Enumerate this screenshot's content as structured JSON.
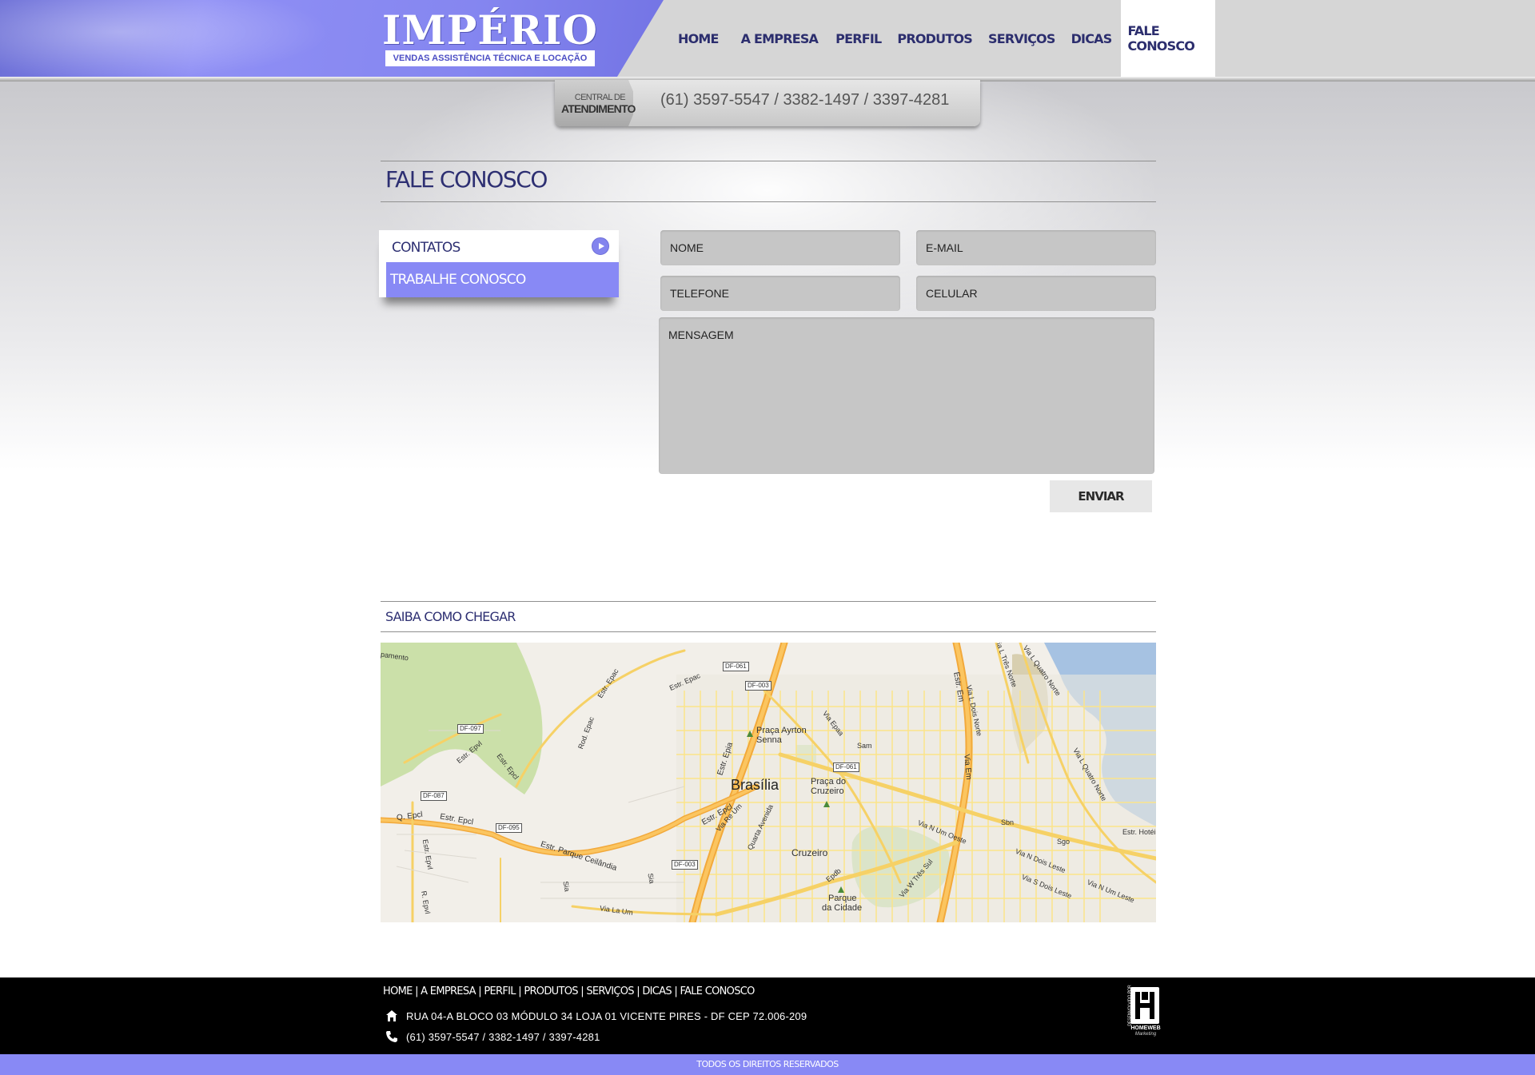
{
  "brand": {
    "name": "IMPÉRIO",
    "tagline": "VENDAS ASSISTÊNCIA TÉCNICA E LOCAÇÃO",
    "accent": "#8889f5",
    "navy": "#2d2f72"
  },
  "nav": {
    "items": [
      "HOME",
      "A EMPRESA",
      "PERFIL",
      "PRODUTOS",
      "SERVIÇOS",
      "DICAS",
      "FALE CONOSCO"
    ],
    "active": "FALE CONOSCO"
  },
  "phone_bar": {
    "label_top": "CENTRAL DE",
    "label_bottom": "ATENDIMENTO",
    "numbers": "(61) 3597-5547 / 3382-1497 / 3397-4281"
  },
  "page": {
    "title": "FALE CONOSCO",
    "side_menu": [
      "CONTATOS",
      "TRABALHE CONOSCO"
    ],
    "side_menu_selected": "TRABALHE CONOSCO"
  },
  "form": {
    "nome": "NOME",
    "email": "E-MAIL",
    "telefone": "TELEFONE",
    "celular": "CELULAR",
    "mensagem": "MENSAGEM",
    "submit": "ENVIAR"
  },
  "map_section": {
    "title": "SAIBA COMO CHEGAR",
    "labels": {
      "city": "Brasília",
      "praca_ayrton_1": "Praça Ayrton",
      "praca_ayrton_2": "Senna",
      "praca_cruzeiro_1": "Praça do",
      "praca_cruzeiro_2": "Cruzeiro",
      "cruzeiro": "Cruzeiro",
      "parque_1": "Parque",
      "parque_2": "da Cidade",
      "estr_epac": "Estr. Epac",
      "estr_epac_2": "Estr. Epac",
      "rod_epac": "Rod. Epac",
      "estr_epvl": "Estr. Epvl",
      "estr_epcl": "Estr. Epcl",
      "estr_epcl_2": "Estr. Epcl",
      "q_epcl": "Q. Epcl",
      "estr_epia": "Estr. Epia",
      "estr_em": "Estr. Em",
      "via_em": "Via Em",
      "estr_parque_ceilandia": "Estr. Parque Ceilândia",
      "via_n_um_oeste": "Via N Um Oeste",
      "via_n_dois_leste": "Via N Dois Leste",
      "via_s_dois_leste": "Via S Dois Leste",
      "via_l_dois_norte": "Via L Dois Norte",
      "via_l_tres_norte": "Via L Três Norte",
      "via_l_quatro_norte": "Via L Quatro Norte",
      "via_l_quatro_norte_2": "Via L Quatro Norte",
      "via_w_tres_sul": "Via W Três Sul",
      "via_epaa": "Via Epaa",
      "via_re_um": "Via Re Um",
      "quarta_avenida": "Quarta Avenida",
      "via_la_um": "Via La Um",
      "via_n_um_leste": "Via N Um Leste",
      "estr_hotel": "Estr. Hotéi",
      "sam": "Sam",
      "sbn": "Sbn",
      "sgo": "Sgo",
      "sia": "Sia",
      "sia_2": "Sia",
      "epdb": "Epdb",
      "r_epvl": "R. Epvl",
      "estr_epvl_2": "Estr. Epvl",
      "pamento": "pamento",
      "df_061": "DF-061",
      "df_003": "DF-003",
      "df_097": "DF-097",
      "df_087": "DF-087",
      "df_095": "DF-095",
      "df_061_b": "DF-061",
      "df_003_b": "DF-003"
    }
  },
  "footer": {
    "links": "HOME | A EMPRESA | PERFIL | PRODUTOS | SERVIÇOS | DICAS | FALE CONOSCO",
    "address": "RUA 04-A BLOCO 03 MÓDULO 34 LOJA 01 VICENTE PIRES - DF CEP 72.006-209",
    "phones": "(61) 3597-5547 / 3382-1497 / 3397-4281",
    "credit_vertical": "DESENVOLVIDO POR",
    "credit_name": "HOMEWEB",
    "credit_sub": "Marketing",
    "copyright": "TODOS OS DIREITOS RESERVADOS"
  }
}
